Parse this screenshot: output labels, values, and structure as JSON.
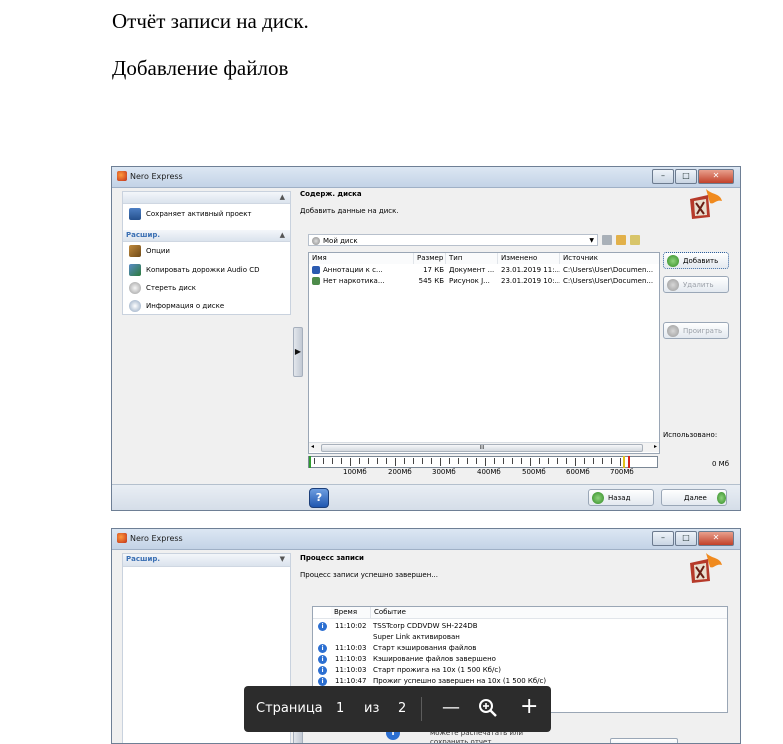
{
  "document": {
    "heading": "Отчёт записи на диск.",
    "subheading": "Добавление файлов"
  },
  "window1": {
    "title": "Nero Express",
    "left_panel": {
      "section1_label": "",
      "save_project": "Сохраняет активный проект",
      "section2_label": "Расшир.",
      "items": [
        "Опции",
        "Копировать дорожки Audio CD",
        "Стереть диск",
        "Информация о диске"
      ]
    },
    "header_title": "Содерж. диска",
    "header_subtitle": "Добавить данные на диск.",
    "disc_combo": "Мой диск",
    "columns": [
      "Имя",
      "Размер",
      "Тип",
      "Изменено",
      "Источник"
    ],
    "files": [
      {
        "name": "Аннотации к с...",
        "size": "17 КБ",
        "type": "Документ ...",
        "modified": "23.01.2019 11:...",
        "source": "C:\\Users\\User\\Documen..."
      },
      {
        "name": "Нет наркотика...",
        "size": "545 КБ",
        "type": "Рисунок J...",
        "modified": "23.01.2019 10:...",
        "source": "C:\\Users\\User\\Documen..."
      }
    ],
    "buttons": {
      "add": "Добавить",
      "delete": "Удалить",
      "play": "Проиграть",
      "back": "Назад",
      "next": "Далее"
    },
    "used_label": "Использовано:",
    "used_value": "0 Мб",
    "scroll_grip": "III",
    "ruler_labels": [
      "100Мб",
      "200Мб",
      "300Мб",
      "400Мб",
      "500Мб",
      "600Мб",
      "700Мб"
    ],
    "help": "?"
  },
  "window2": {
    "title": "Nero Express",
    "left_section": "Расшир.",
    "header_title": "Процесс записи",
    "header_subtitle": "Процесс записи успешно завершен...",
    "columns": [
      "Время",
      "Событие"
    ],
    "log": [
      {
        "time": "11:10:02",
        "event": "TSSTcorp CDDVDW SH-224DB"
      },
      {
        "time": "",
        "event": "Super Link активирован"
      },
      {
        "time": "11:10:03",
        "event": "Старт кэширования файлов"
      },
      {
        "time": "11:10:03",
        "event": "Кэширование файлов завершено"
      },
      {
        "time": "11:10:03",
        "event": "Старт прожига на 10x (1 500 Кб/с)"
      },
      {
        "time": "11:10:47",
        "event": "Прожиг успешно завершен на 10x (1 500 Кб/с)"
      }
    ],
    "footer_text": "Процесс записи завершен. Вы можете распечатать или сохранить отчет."
  },
  "viewer": {
    "page_label": "Страница",
    "current_page": "1",
    "of_label": "из",
    "total_pages": "2",
    "zoom_out": "—",
    "zoom_in": "+"
  }
}
